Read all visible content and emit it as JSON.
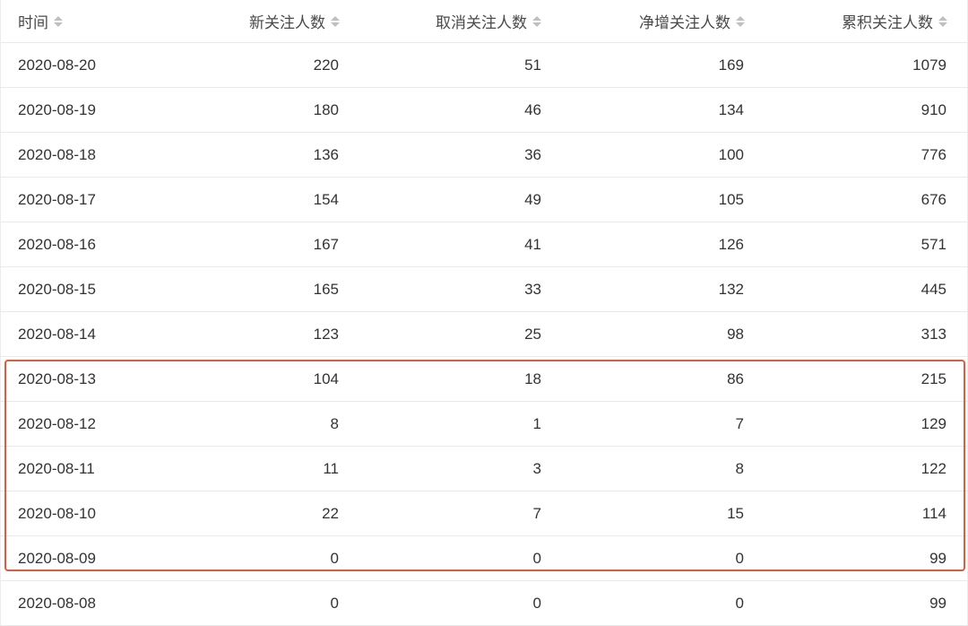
{
  "table": {
    "headers": [
      "时间",
      "新关注人数",
      "取消关注人数",
      "净增关注人数",
      "累积关注人数"
    ],
    "rows": [
      [
        "2020-08-20",
        "220",
        "51",
        "169",
        "1079"
      ],
      [
        "2020-08-19",
        "180",
        "46",
        "134",
        "910"
      ],
      [
        "2020-08-18",
        "136",
        "36",
        "100",
        "776"
      ],
      [
        "2020-08-17",
        "154",
        "49",
        "105",
        "676"
      ],
      [
        "2020-08-16",
        "167",
        "41",
        "126",
        "571"
      ],
      [
        "2020-08-15",
        "165",
        "33",
        "132",
        "445"
      ],
      [
        "2020-08-14",
        "123",
        "25",
        "98",
        "313"
      ],
      [
        "2020-08-13",
        "104",
        "18",
        "86",
        "215"
      ],
      [
        "2020-08-12",
        "8",
        "1",
        "7",
        "129"
      ],
      [
        "2020-08-11",
        "11",
        "3",
        "8",
        "122"
      ],
      [
        "2020-08-10",
        "22",
        "7",
        "15",
        "114"
      ],
      [
        "2020-08-09",
        "0",
        "0",
        "0",
        "99"
      ],
      [
        "2020-08-08",
        "0",
        "0",
        "0",
        "99"
      ]
    ]
  },
  "colors": {
    "highlight_border": "#e05a3b",
    "sort_icon": "#bfbfbf",
    "row_divider": "#e9e9e9"
  },
  "icons": {
    "sort": "sort-caret-icon"
  }
}
